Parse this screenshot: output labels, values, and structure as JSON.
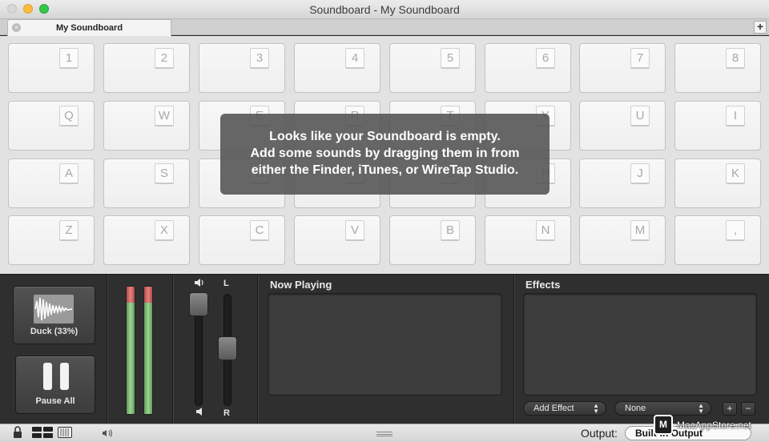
{
  "window": {
    "title": "Soundboard - My Soundboard"
  },
  "tabs": [
    {
      "label": "My Soundboard",
      "close": "×"
    }
  ],
  "tab_add": "+",
  "pads": {
    "row1": [
      "1",
      "2",
      "3",
      "4",
      "5",
      "6",
      "7",
      "8"
    ],
    "row2": [
      "Q",
      "W",
      "E",
      "R",
      "T",
      "Y",
      "U",
      "I"
    ],
    "row3": [
      "A",
      "S",
      "D",
      "F",
      "G",
      "H",
      "J",
      "K"
    ],
    "row4": [
      "Z",
      "X",
      "C",
      "V",
      "B",
      "N",
      "M",
      ","
    ]
  },
  "empty_message": {
    "line1": "Looks like your Soundboard is empty.",
    "line2": "Add some sounds by dragging them in from",
    "line3": "either the Finder, iTunes, or WireTap Studio."
  },
  "controls": {
    "duck_label": "Duck (33%)",
    "pause_label": "Pause All",
    "volume_icon": "speaker-icon",
    "balance_left": "L",
    "balance_right": "R",
    "now_playing_title": "Now Playing",
    "effects_title": "Effects",
    "add_effect_label": "Add Effect",
    "effect_select_value": "None",
    "add_button": "+",
    "remove_button": "−"
  },
  "status_bar": {
    "output_label": "Output:",
    "output_value": "Built-in Output"
  },
  "watermark": {
    "badge": "M",
    "text": "MacAppStore.net"
  },
  "colors": {
    "panel_bg": "#2f2f2f",
    "grid_bg": "#e2e2e2",
    "meter_green": "#8fcf86",
    "meter_red": "#d96a6a",
    "close_button": "#d8d8d8",
    "minimize_button": "#fdbc40",
    "maximize_button": "#34c84a"
  }
}
